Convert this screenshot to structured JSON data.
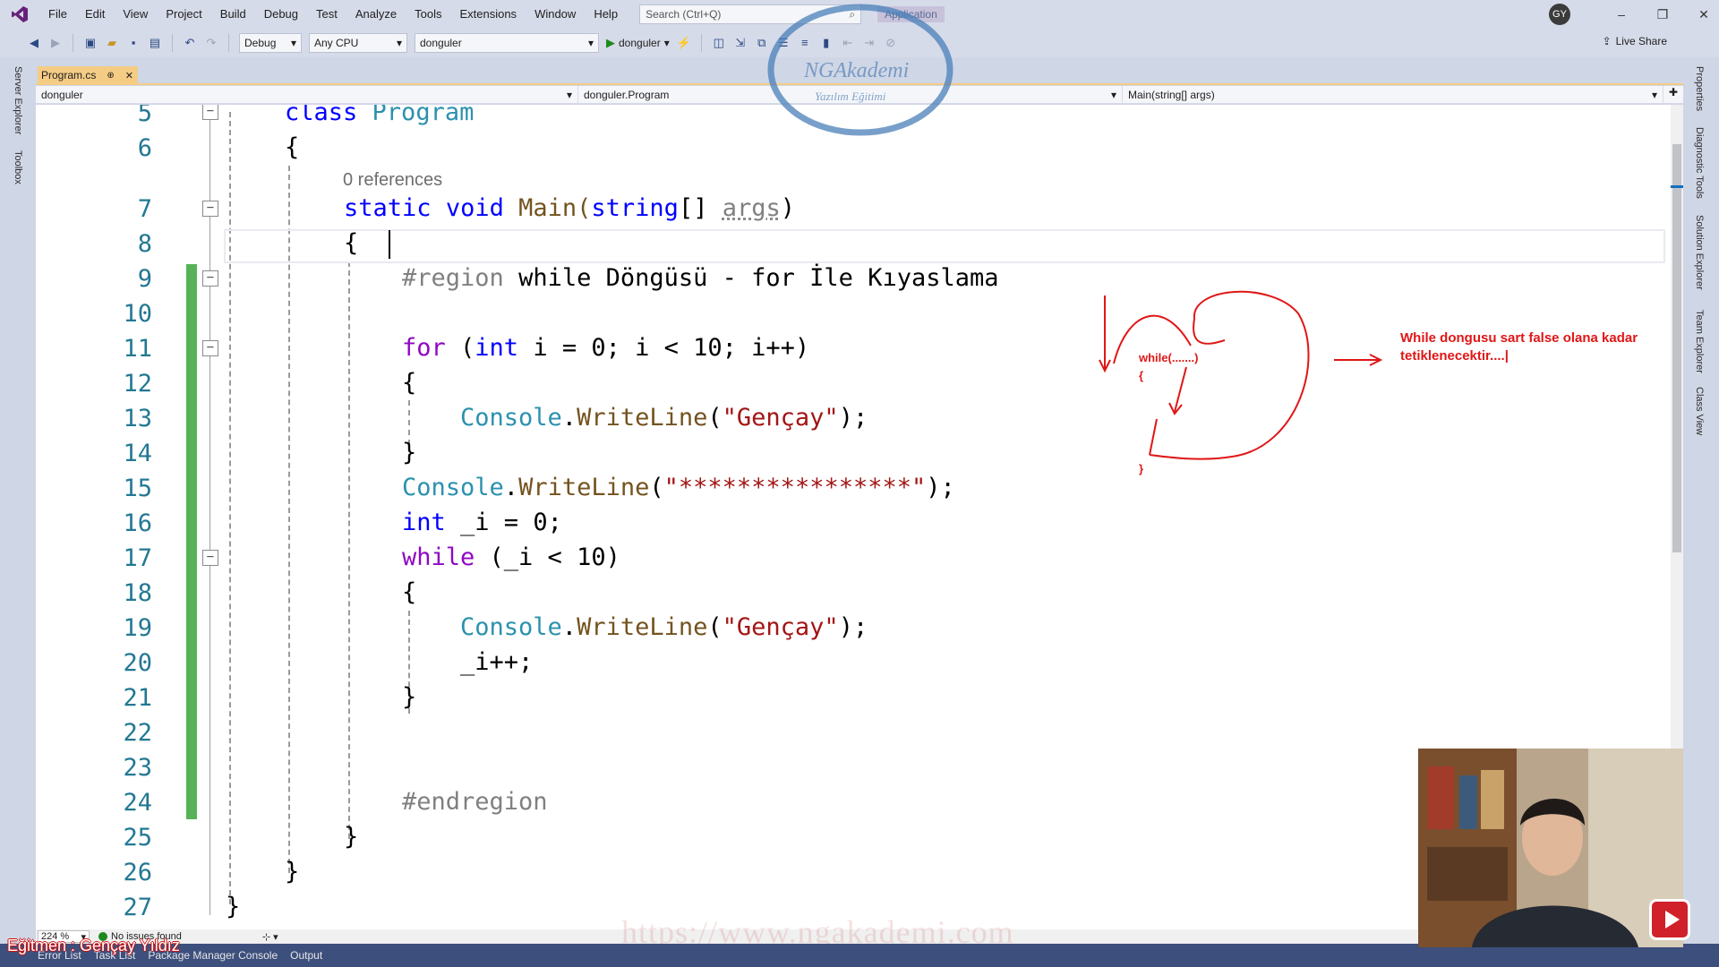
{
  "menubar": {
    "items": [
      "File",
      "Edit",
      "View",
      "Project",
      "Build",
      "Debug",
      "Test",
      "Analyze",
      "Tools",
      "Extensions",
      "Window",
      "Help"
    ],
    "search_placeholder": "Search (Ctrl+Q)",
    "app_title": "Application",
    "user_initials": "GY"
  },
  "toolbar": {
    "config": "Debug",
    "platform": "Any CPU",
    "startup_project": "donguler",
    "run_label": "donguler",
    "live_share": "Live Share"
  },
  "left_tabs": [
    "Server Explorer",
    "Toolbox"
  ],
  "right_tabs": [
    "Properties",
    "Diagnostic Tools",
    "Solution Explorer",
    "Team Explorer",
    "Class View"
  ],
  "document_tab": {
    "name": "Program.cs",
    "pin": "⊕",
    "close": "✕"
  },
  "navbar": {
    "project": "donguler",
    "type": "donguler.Program",
    "member": "Main(string[] args)"
  },
  "editor": {
    "line_numbers": [
      "5",
      "6",
      "7",
      "8",
      "9",
      "10",
      "11",
      "12",
      "13",
      "14",
      "15",
      "16",
      "17",
      "18",
      "19",
      "20",
      "21",
      "22",
      "23",
      "24",
      "25",
      "26",
      "27"
    ],
    "references": "0 references",
    "lines": {
      "l5": {
        "kw": "class",
        "name": "Program"
      },
      "l6": "{",
      "l7": {
        "kw1": "static",
        "kw2": "void",
        "name": "Main(",
        "type": "string",
        "rest": "[] ",
        "arg": "args",
        "close": ")"
      },
      "l8": "{",
      "l9": {
        "kw": "#region",
        "text": "while Döngüsü - for İle Kıyaslama"
      },
      "l11": {
        "kw": "for",
        "a": " (",
        "int": "int",
        "b": " i = 0; i < 10; i++)"
      },
      "l12": "{",
      "l13": {
        "cls": "Console",
        "dot": ".",
        "mth": "WriteLine",
        "open": "(",
        "str": "\"Gençay\"",
        "close": ");"
      },
      "l14": "}",
      "l15": {
        "cls": "Console",
        "dot": ".",
        "mth": "WriteLine",
        "open": "(",
        "str": "\"****************\"",
        "close": ");"
      },
      "l16": {
        "kw": "int",
        "rest": " _i = 0;"
      },
      "l17": {
        "kw": "while",
        "rest": " (_i < 10)"
      },
      "l18": "{",
      "l19": {
        "cls": "Console",
        "dot": ".",
        "mth": "WriteLine",
        "open": "(",
        "str": "\"Gençay\"",
        "close": ");"
      },
      "l20": "_i++;",
      "l21": "}",
      "l24": "#endregion",
      "l25": "}",
      "l26": "}",
      "l27": "}"
    }
  },
  "annotation": {
    "text": "While dongusu sart false olana kadar tetiklenecektir....|",
    "sketch_while": "while(.......)",
    "sketch_open": "{",
    "sketch_close": "}",
    "color": "#e01616"
  },
  "statusbar": {
    "zoom": "224 %",
    "issues": "No issues found"
  },
  "bottom_tabs": [
    "Error List",
    "Task List",
    "Package Manager Console",
    "Output"
  ],
  "overlay": {
    "instructor": "Eğitmen : Gençay Yıldız",
    "watermark": "https://www.ngakademi.com",
    "logo_line1": "NGAkademi",
    "logo_line2": "Yazılım Eğitimi"
  }
}
